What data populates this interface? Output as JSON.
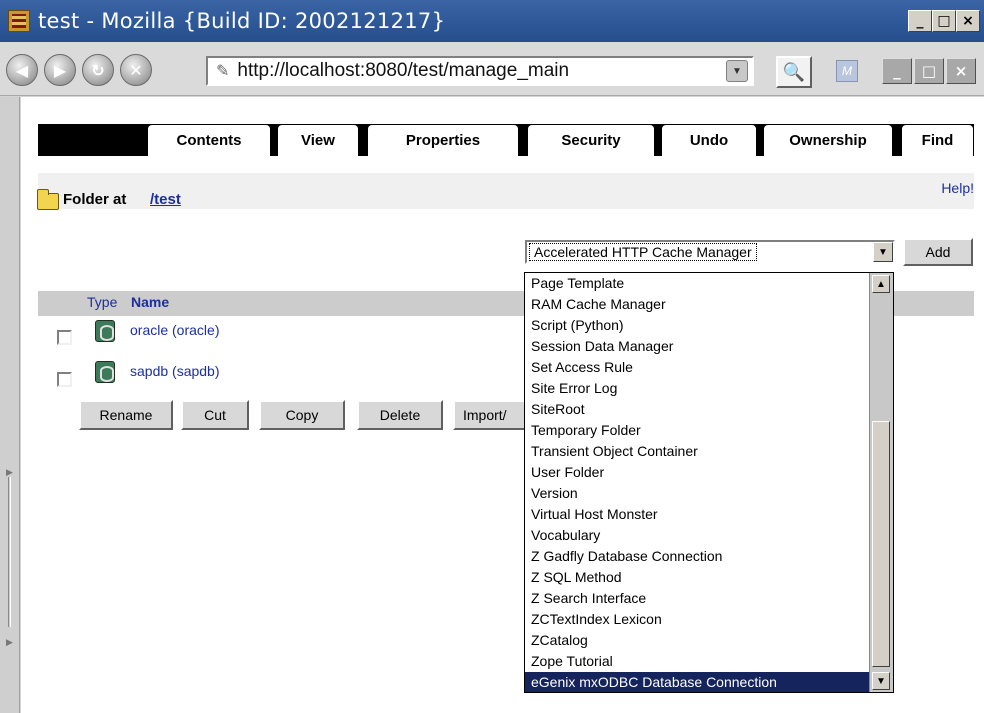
{
  "window": {
    "title": "test - Mozilla {Build ID: 2002121217}",
    "controls": [
      "_",
      "□",
      "×"
    ]
  },
  "nav": {
    "url": "http://localhost:8080/test/manage_main",
    "back_icon": "back-icon",
    "forward_icon": "forward-icon",
    "reload_icon": "reload-icon",
    "stop_icon": "stop-icon",
    "mini_buttons": [
      "_",
      "□",
      "×"
    ]
  },
  "tabs": [
    {
      "label": "Contents",
      "active": true
    },
    {
      "label": "View",
      "active": false
    },
    {
      "label": "Properties",
      "active": false
    },
    {
      "label": "Security",
      "active": false
    },
    {
      "label": "Undo",
      "active": false
    },
    {
      "label": "Ownership",
      "active": false
    },
    {
      "label": "Find",
      "active": false
    }
  ],
  "folder": {
    "label": "Folder at",
    "path": "/test",
    "help": "Help!"
  },
  "add": {
    "selected": "Accelerated HTTP Cache Manager",
    "button": "Add"
  },
  "table": {
    "type_header": "Type",
    "name_header": "Name",
    "rows": [
      {
        "name": "oracle (oracle)"
      },
      {
        "name": "sapdb (sapdb)"
      }
    ]
  },
  "actions": [
    "Rename",
    "Cut",
    "Copy",
    "Delete",
    "Import/"
  ],
  "dropdown": {
    "options": [
      "Page Template",
      "RAM Cache Manager",
      "Script (Python)",
      "Session Data Manager",
      "Set Access Rule",
      "Site Error Log",
      "SiteRoot",
      "Temporary Folder",
      "Transient Object Container",
      "User Folder",
      "Version",
      "Virtual Host Monster",
      "Vocabulary",
      "Z Gadfly Database Connection",
      "Z SQL Method",
      "Z Search Interface",
      "ZCTextIndex Lexicon",
      "ZCatalog",
      "Zope Tutorial",
      "eGenix mxODBC Database Connection"
    ],
    "selected_index": 19
  }
}
